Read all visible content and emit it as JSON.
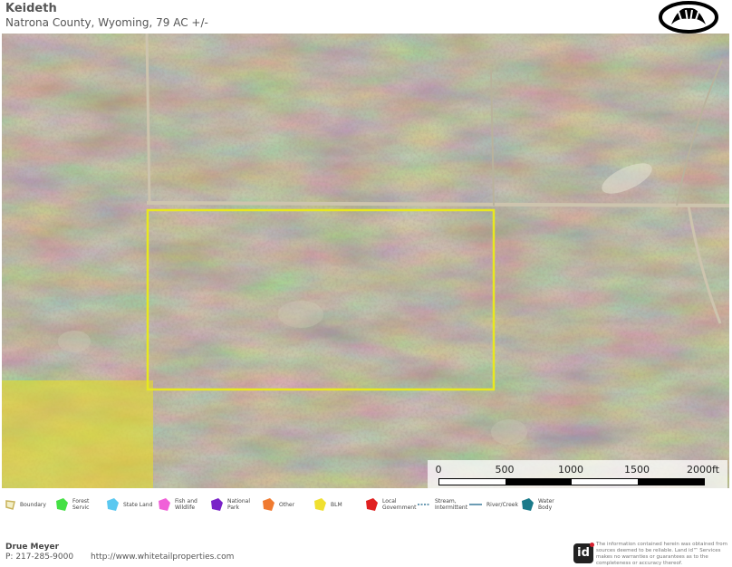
{
  "header": {
    "title": "Keideth",
    "subtitle": "Natrona County, Wyoming, 79 AC +/-"
  },
  "map": {
    "scale": {
      "labels": [
        "0",
        "500",
        "1000",
        "1500",
        "2000ft"
      ]
    },
    "boundary_color": "#e8e81e",
    "blm_color": "#e6dc2a"
  },
  "legend": {
    "items": [
      {
        "label": "Boundary",
        "color": "#c8b25a",
        "icon": "boundary-icon"
      },
      {
        "label": "Forest Servic",
        "color": "#44e044",
        "icon": "forest-service-icon"
      },
      {
        "label": "State Land",
        "color": "#5bc8f0",
        "icon": "state-land-icon"
      },
      {
        "label": "Fish and Wildlife",
        "color": "#f060d8",
        "icon": "fish-and-wildlife-icon"
      },
      {
        "label": "National Park",
        "color": "#7a22c8",
        "icon": "national-park-icon"
      },
      {
        "label": "Other",
        "color": "#f07a30",
        "icon": "other-icon"
      },
      {
        "label": "BLM",
        "color": "#f0e030",
        "icon": "blm-icon"
      },
      {
        "label": "Local Government",
        "color": "#e02020",
        "icon": "local-government-icon"
      },
      {
        "label": "Stream, Intermittent",
        "color": "#3a7a9a",
        "icon": "stream-intermittent-icon"
      },
      {
        "label": "River/Creek",
        "color": "#3a7a9a",
        "icon": "river-creek-icon"
      },
      {
        "label": "Water Body",
        "color": "#1a7a8a",
        "icon": "water-body-icon"
      }
    ]
  },
  "footer": {
    "agent_name": "Drue Meyer",
    "agent_phone": "P: 217-285-9000",
    "website": "http://www.whitetailproperties.com",
    "id_logo": "id",
    "disclaimer": "The information contained herein was obtained from sources deemed to be reliable. Land id™ Services makes no warranties or guarantees as to the completeness or accuracy thereof."
  }
}
